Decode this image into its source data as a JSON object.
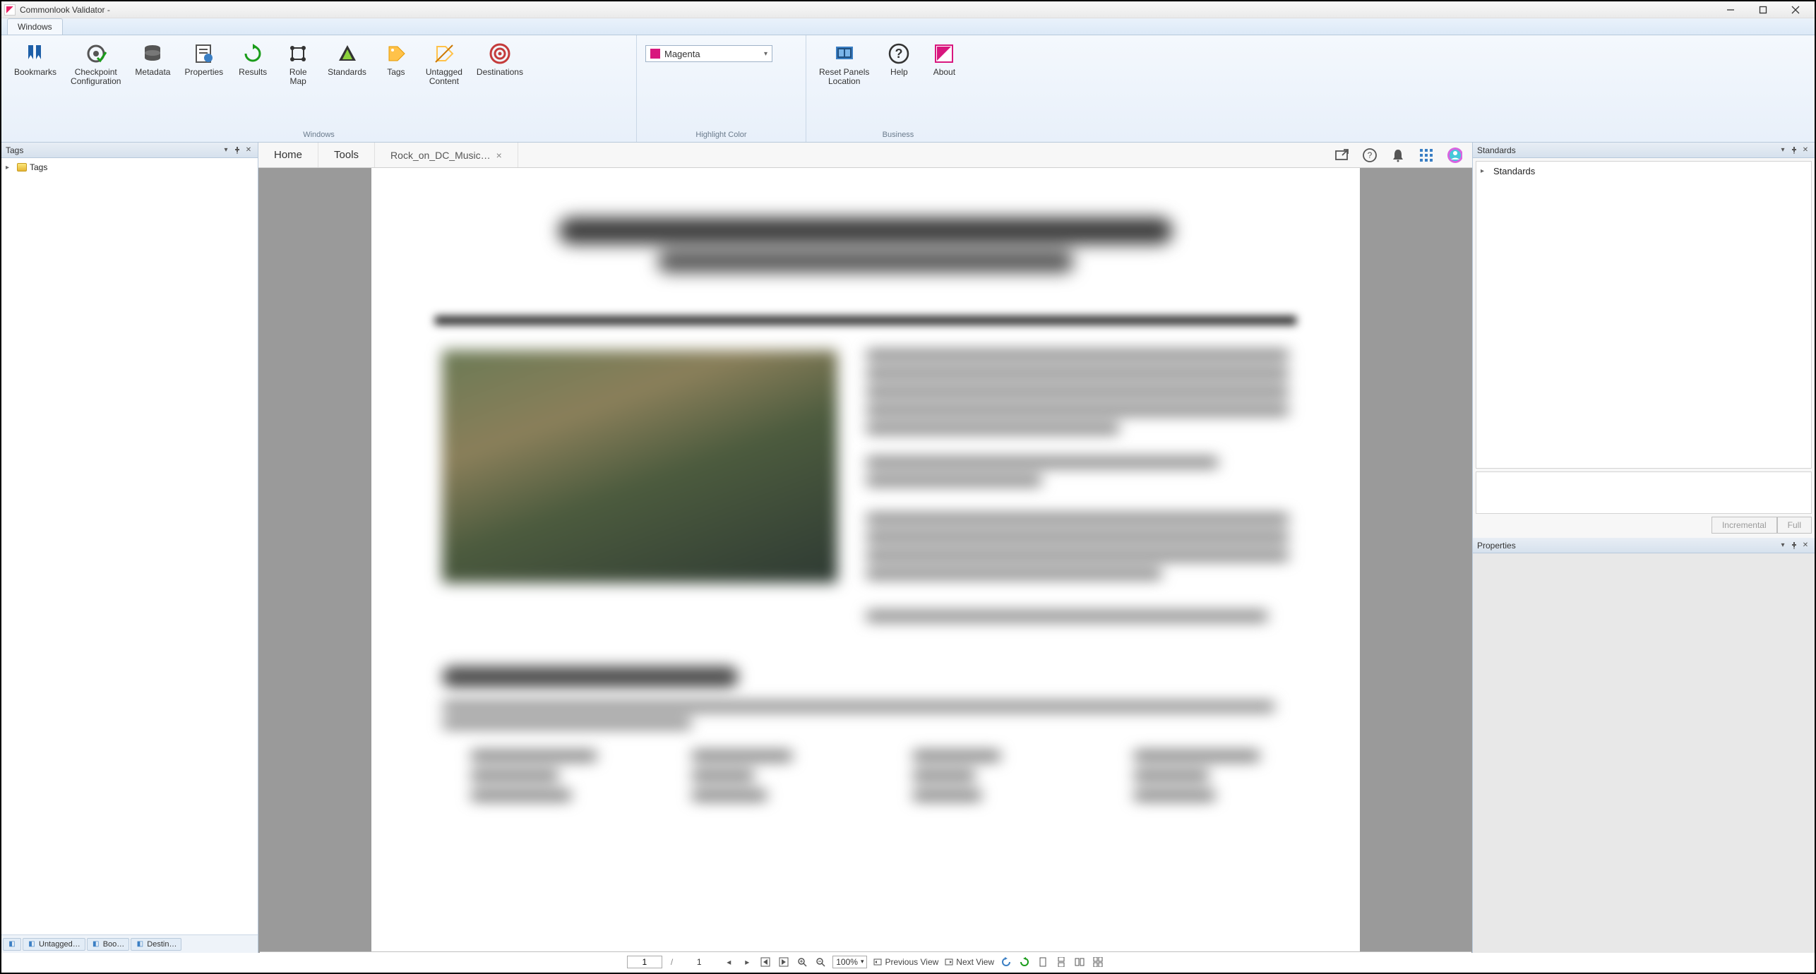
{
  "app": {
    "title": "Commonlook Validator -"
  },
  "ribbon": {
    "tab": "Windows",
    "groups": {
      "windows": {
        "label": "Windows",
        "buttons": {
          "bookmarks": "Bookmarks",
          "checkpoint": "Checkpoint\nConfiguration",
          "metadata": "Metadata",
          "properties": "Properties",
          "results": "Results",
          "rolemap": "Role\nMap",
          "standards": "Standards",
          "tags": "Tags",
          "untagged": "Untagged\nContent",
          "destinations": "Destinations"
        }
      },
      "highlight": {
        "label": "Highlight Color",
        "selected": "Magenta"
      },
      "business": {
        "label": "Business",
        "buttons": {
          "reset": "Reset Panels\nLocation",
          "help": "Help",
          "about": "About"
        }
      }
    }
  },
  "left_panel": {
    "title": "Tags",
    "tree_root": "Tags",
    "bottom_tabs": [
      "Untagged…",
      "Boo…",
      "Destin…"
    ]
  },
  "doc": {
    "tabs": [
      "Home",
      "Tools"
    ],
    "file_tab": "Rock_on_DC_Music…"
  },
  "right": {
    "standards_title": "Standards",
    "standards_root": "Standards",
    "incremental": "Incremental",
    "full": "Full",
    "properties_title": "Properties"
  },
  "status": {
    "page_current": "1",
    "page_sep": "/",
    "page_total": "1",
    "zoom": "100%",
    "prev_view": "Previous View",
    "next_view": "Next View"
  }
}
